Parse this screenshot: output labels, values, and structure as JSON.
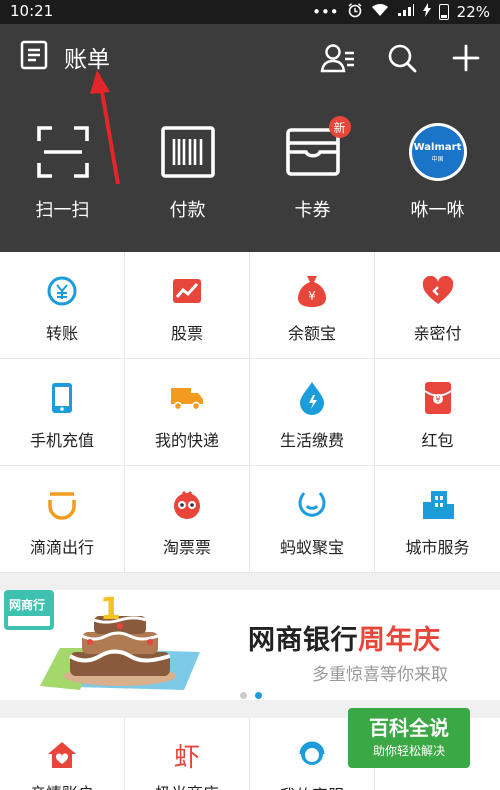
{
  "status_bar": {
    "time": "10:21",
    "dots": "•••",
    "battery": "22%"
  },
  "header": {
    "bill_label": "账单",
    "actions": [
      {
        "label": "扫一扫"
      },
      {
        "label": "付款"
      },
      {
        "label": "卡券",
        "badge": "新"
      },
      {
        "label": "咻一咻",
        "logo_text": "Walmart",
        "logo_sub": "中国"
      }
    ]
  },
  "grid": [
    [
      {
        "label": "转账",
        "icon": "transfer-icon",
        "color": "#1b9ddb"
      },
      {
        "label": "股票",
        "icon": "stock-chart-icon",
        "color": "#e8463b"
      },
      {
        "label": "余额宝",
        "icon": "money-bag-icon",
        "color": "#e8463b"
      },
      {
        "label": "亲密付",
        "icon": "heart-icon",
        "color": "#e8463b"
      }
    ],
    [
      {
        "label": "手机充值",
        "icon": "phone-icon",
        "color": "#1b9ddb"
      },
      {
        "label": "我的快递",
        "icon": "truck-icon",
        "color": "#f29b1e"
      },
      {
        "label": "生活缴费",
        "icon": "water-drop-icon",
        "color": "#1b9ddb"
      },
      {
        "label": "红包",
        "icon": "red-envelope-icon",
        "color": "#e8463b"
      }
    ],
    [
      {
        "label": "滴滴出行",
        "icon": "didi-icon",
        "color": "#f29b1e"
      },
      {
        "label": "淘票票",
        "icon": "movie-mascot-icon",
        "color": "#e8463b"
      },
      {
        "label": "蚂蚁聚宝",
        "icon": "ant-treasure-icon",
        "color": "#1b9ddb"
      },
      {
        "label": "城市服务",
        "icon": "city-building-icon",
        "color": "#1b9ddb"
      }
    ]
  ],
  "banner": {
    "badge_text": "网商行",
    "cake_number": "1",
    "title_main": "网商银行",
    "title_accent": "周年庆",
    "subtitle": "多重惊喜等你来取"
  },
  "bottom_row": [
    {
      "label": "亲情账户",
      "icon": "family-home-icon",
      "color": "#e8463b"
    },
    {
      "label": "极光商店",
      "icon": "shrimp-icon",
      "color": "#e8463b"
    },
    {
      "label": "我的客服",
      "icon": "service-agent-icon",
      "color": "#1b9ddb"
    },
    {
      "label": ""
    }
  ],
  "watermark": {
    "title": "百科全说",
    "subtitle": "助你轻松解决"
  },
  "colors": {
    "header_bg": "#3c3c3c",
    "accent_red": "#e8463b",
    "accent_blue": "#1b9ddb"
  }
}
